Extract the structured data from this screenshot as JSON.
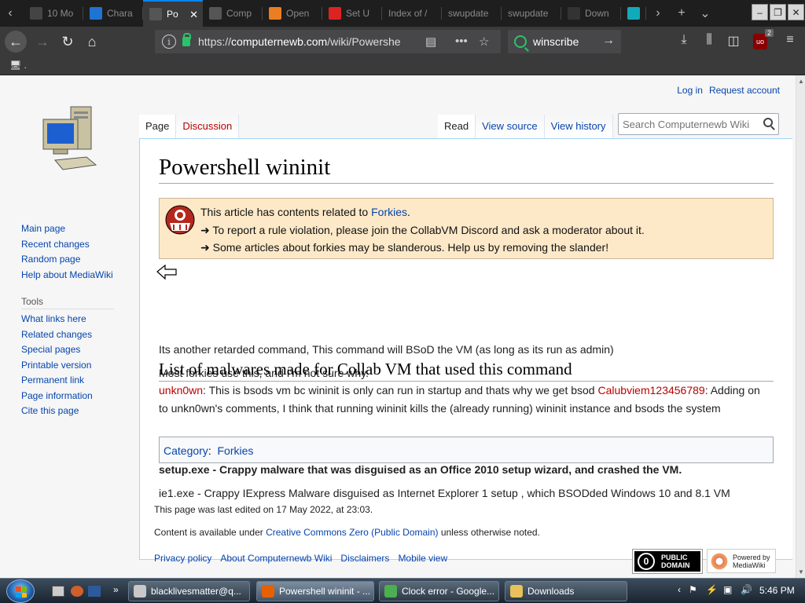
{
  "browser": {
    "tabs": [
      {
        "label": "10 Mo",
        "icon": "number-ten-icon",
        "color": "#444"
      },
      {
        "label": "Chara",
        "icon": "unicode-icon",
        "color": "#1f74d1"
      },
      {
        "label": "Po",
        "icon": "computer-icon",
        "color": "#555",
        "active": true
      },
      {
        "label": "Comp",
        "icon": "computer-icon",
        "color": "#555"
      },
      {
        "label": "Open",
        "icon": "openvpn-icon",
        "color": "#ea7e20"
      },
      {
        "label": "Set U",
        "icon": "setup-icon",
        "color": "#d22"
      },
      {
        "label": "Index of /",
        "icon": "",
        "color": ""
      },
      {
        "label": "swupdate",
        "icon": "",
        "color": ""
      },
      {
        "label": "swupdate",
        "icon": "",
        "color": ""
      },
      {
        "label": "Down",
        "icon": "wordpress-icon",
        "color": "#333"
      },
      {
        "label": "",
        "icon": "teal-logo-icon",
        "color": "#1ab"
      }
    ],
    "tab_close": "✕",
    "address": {
      "prefix": "https://",
      "host": "computernewb.com",
      "path": "/wiki/Powershe"
    },
    "search_engine_value": "winscribe",
    "ublock_count": "2",
    "bookmark_label": "."
  },
  "page": {
    "personal": {
      "login": "Log in",
      "request": "Request account"
    },
    "tabs_left": [
      "Page",
      "Discussion"
    ],
    "tabs_right": [
      "Read",
      "View source",
      "View history"
    ],
    "search_placeholder": "Search Computernewb Wiki",
    "title": "Powershell wininit",
    "notice": {
      "line1_prefix": "This article has contents related to ",
      "line1_link": "Forkies",
      "line1_suffix": ".",
      "line2": "➜ To report a rule violation, please join the CollabVM Discord and ask a moderator about it.",
      "line3": "➜ Some articles about forkies may be slanderous. Help us by removing the slander!"
    },
    "paragraph1": "Its another retarded command, This command will BSoD the VM (as long as its run as admin)",
    "paragraph2": "Most forkies use this, and I'm not sure why.",
    "comment": {
      "user1": "unkn0wn",
      "text1": ": This is bsods vm bc wininit is only can run in startup and thats why we get bsod ",
      "user2": "Calubviem123456789",
      "text2": ": Adding on",
      "text3": "to unkn0wn's comments, I think that running wininit kills the (already running) wininit instance and bsods the system"
    },
    "section_heading": "List of malwares made for Collab VM that used this command",
    "malware1": "setup.exe - Crappy malware that was disguised as an Office 2010 setup wizard, and crashed the VM.",
    "malware2": "ie1.exe - Crappy IExpress Malware disguised as Internet Explorer 1 setup , which BSODded Windows 10 and 8.1 VM",
    "category_label": "Category",
    "category_value": "Forkies"
  },
  "sidebar": {
    "nav": [
      "Main page",
      "Recent changes",
      "Random page",
      "Help about MediaWiki"
    ],
    "tools_header": "Tools",
    "tools": [
      "What links here",
      "Related changes",
      "Special pages",
      "Printable version",
      "Permanent link",
      "Page information",
      "Cite this page"
    ]
  },
  "footer": {
    "last_edited": "This page was last edited on 17 May 2022, at 23:03.",
    "license_prefix": "Content is available under ",
    "license_link": "Creative Commons Zero (Public Domain)",
    "license_suffix": " unless otherwise noted.",
    "links": [
      "Privacy policy",
      "About Computernewb Wiki",
      "Disclaimers",
      "Mobile view"
    ],
    "pd_badge": [
      "PUBLIC",
      "DOMAIN"
    ],
    "mw_badge": [
      "Powered by",
      "MediaWiki"
    ]
  },
  "taskbar": {
    "buttons": [
      {
        "label": "blacklivesmatter@q...",
        "icon": "putty-icon"
      },
      {
        "label": "Powershell wininit - ...",
        "icon": "firefox-icon",
        "active": true
      },
      {
        "label": "Clock error - Google...",
        "icon": "chrome-icon"
      },
      {
        "label": "Downloads",
        "icon": "folder-icon"
      }
    ],
    "time": "5:46 PM"
  },
  "colors": {
    "link": "#0645ad",
    "redlink": "#ba0000",
    "notice_bg": "#fde9c8",
    "tab_active_accent": "#0a84ff"
  }
}
